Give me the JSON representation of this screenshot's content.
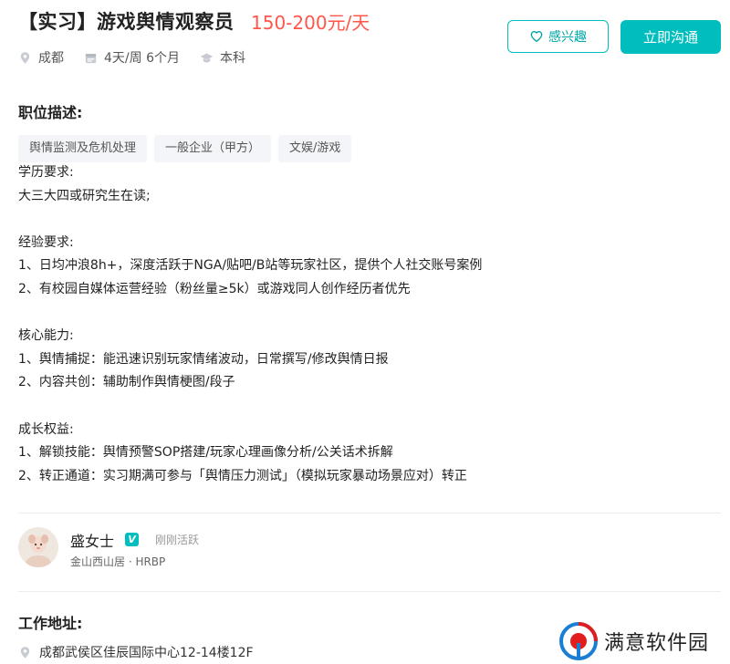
{
  "job": {
    "title": "【实习】游戏舆情观察员",
    "salary": "150-200元/天",
    "city": "成都",
    "schedule": "4天/周 6个月",
    "education": "本科"
  },
  "actions": {
    "interest_label": "感兴趣",
    "chat_label": "立即沟通"
  },
  "sections": {
    "description_title": "职位描述:",
    "address_title": "工作地址:"
  },
  "tags": [
    "舆情监测及危机处理",
    "一般企业（甲方）",
    "文娱/游戏"
  ],
  "description": [
    "学历要求:",
    "大三大四或研究生在读;",
    "",
    "经验要求:",
    "1、日均冲浪8h+，深度活跃于NGA/贴吧/B站等玩家社区，提供个人社交账号案例",
    "2、有校园自媒体运营经验（粉丝量≥5k）或游戏同人创作经历者优先",
    "",
    "核心能力:",
    "1、舆情捕捉：能迅速识别玩家情绪波动，日常撰写/修改舆情日报",
    "2、内容共创：辅助制作舆情梗图/段子",
    "",
    "成长权益:",
    "1、解锁技能：舆情预警SOP搭建/玩家心理画像分析/公关话术拆解",
    "2、转正通道：实习期满可参与「舆情压力测试」（模拟玩家暴动场景应对）转正"
  ],
  "recruiter": {
    "name": "盛女士",
    "verified_badge": "V",
    "status": "刚刚活跃",
    "company_role": "金山西山居 · HRBP"
  },
  "address": {
    "text": "成都武侯区佳辰国际中心12-14楼12F"
  },
  "watermark": {
    "text": "满意软件园"
  },
  "colors": {
    "accent": "#00bebd",
    "salary": "#fe574a",
    "tag_bg": "#f3f5f8"
  },
  "icons": {
    "city": "location-pin-icon",
    "schedule": "calendar-icon",
    "education": "graduation-cap-icon",
    "interest": "heart-icon",
    "address": "location-pin-icon"
  }
}
